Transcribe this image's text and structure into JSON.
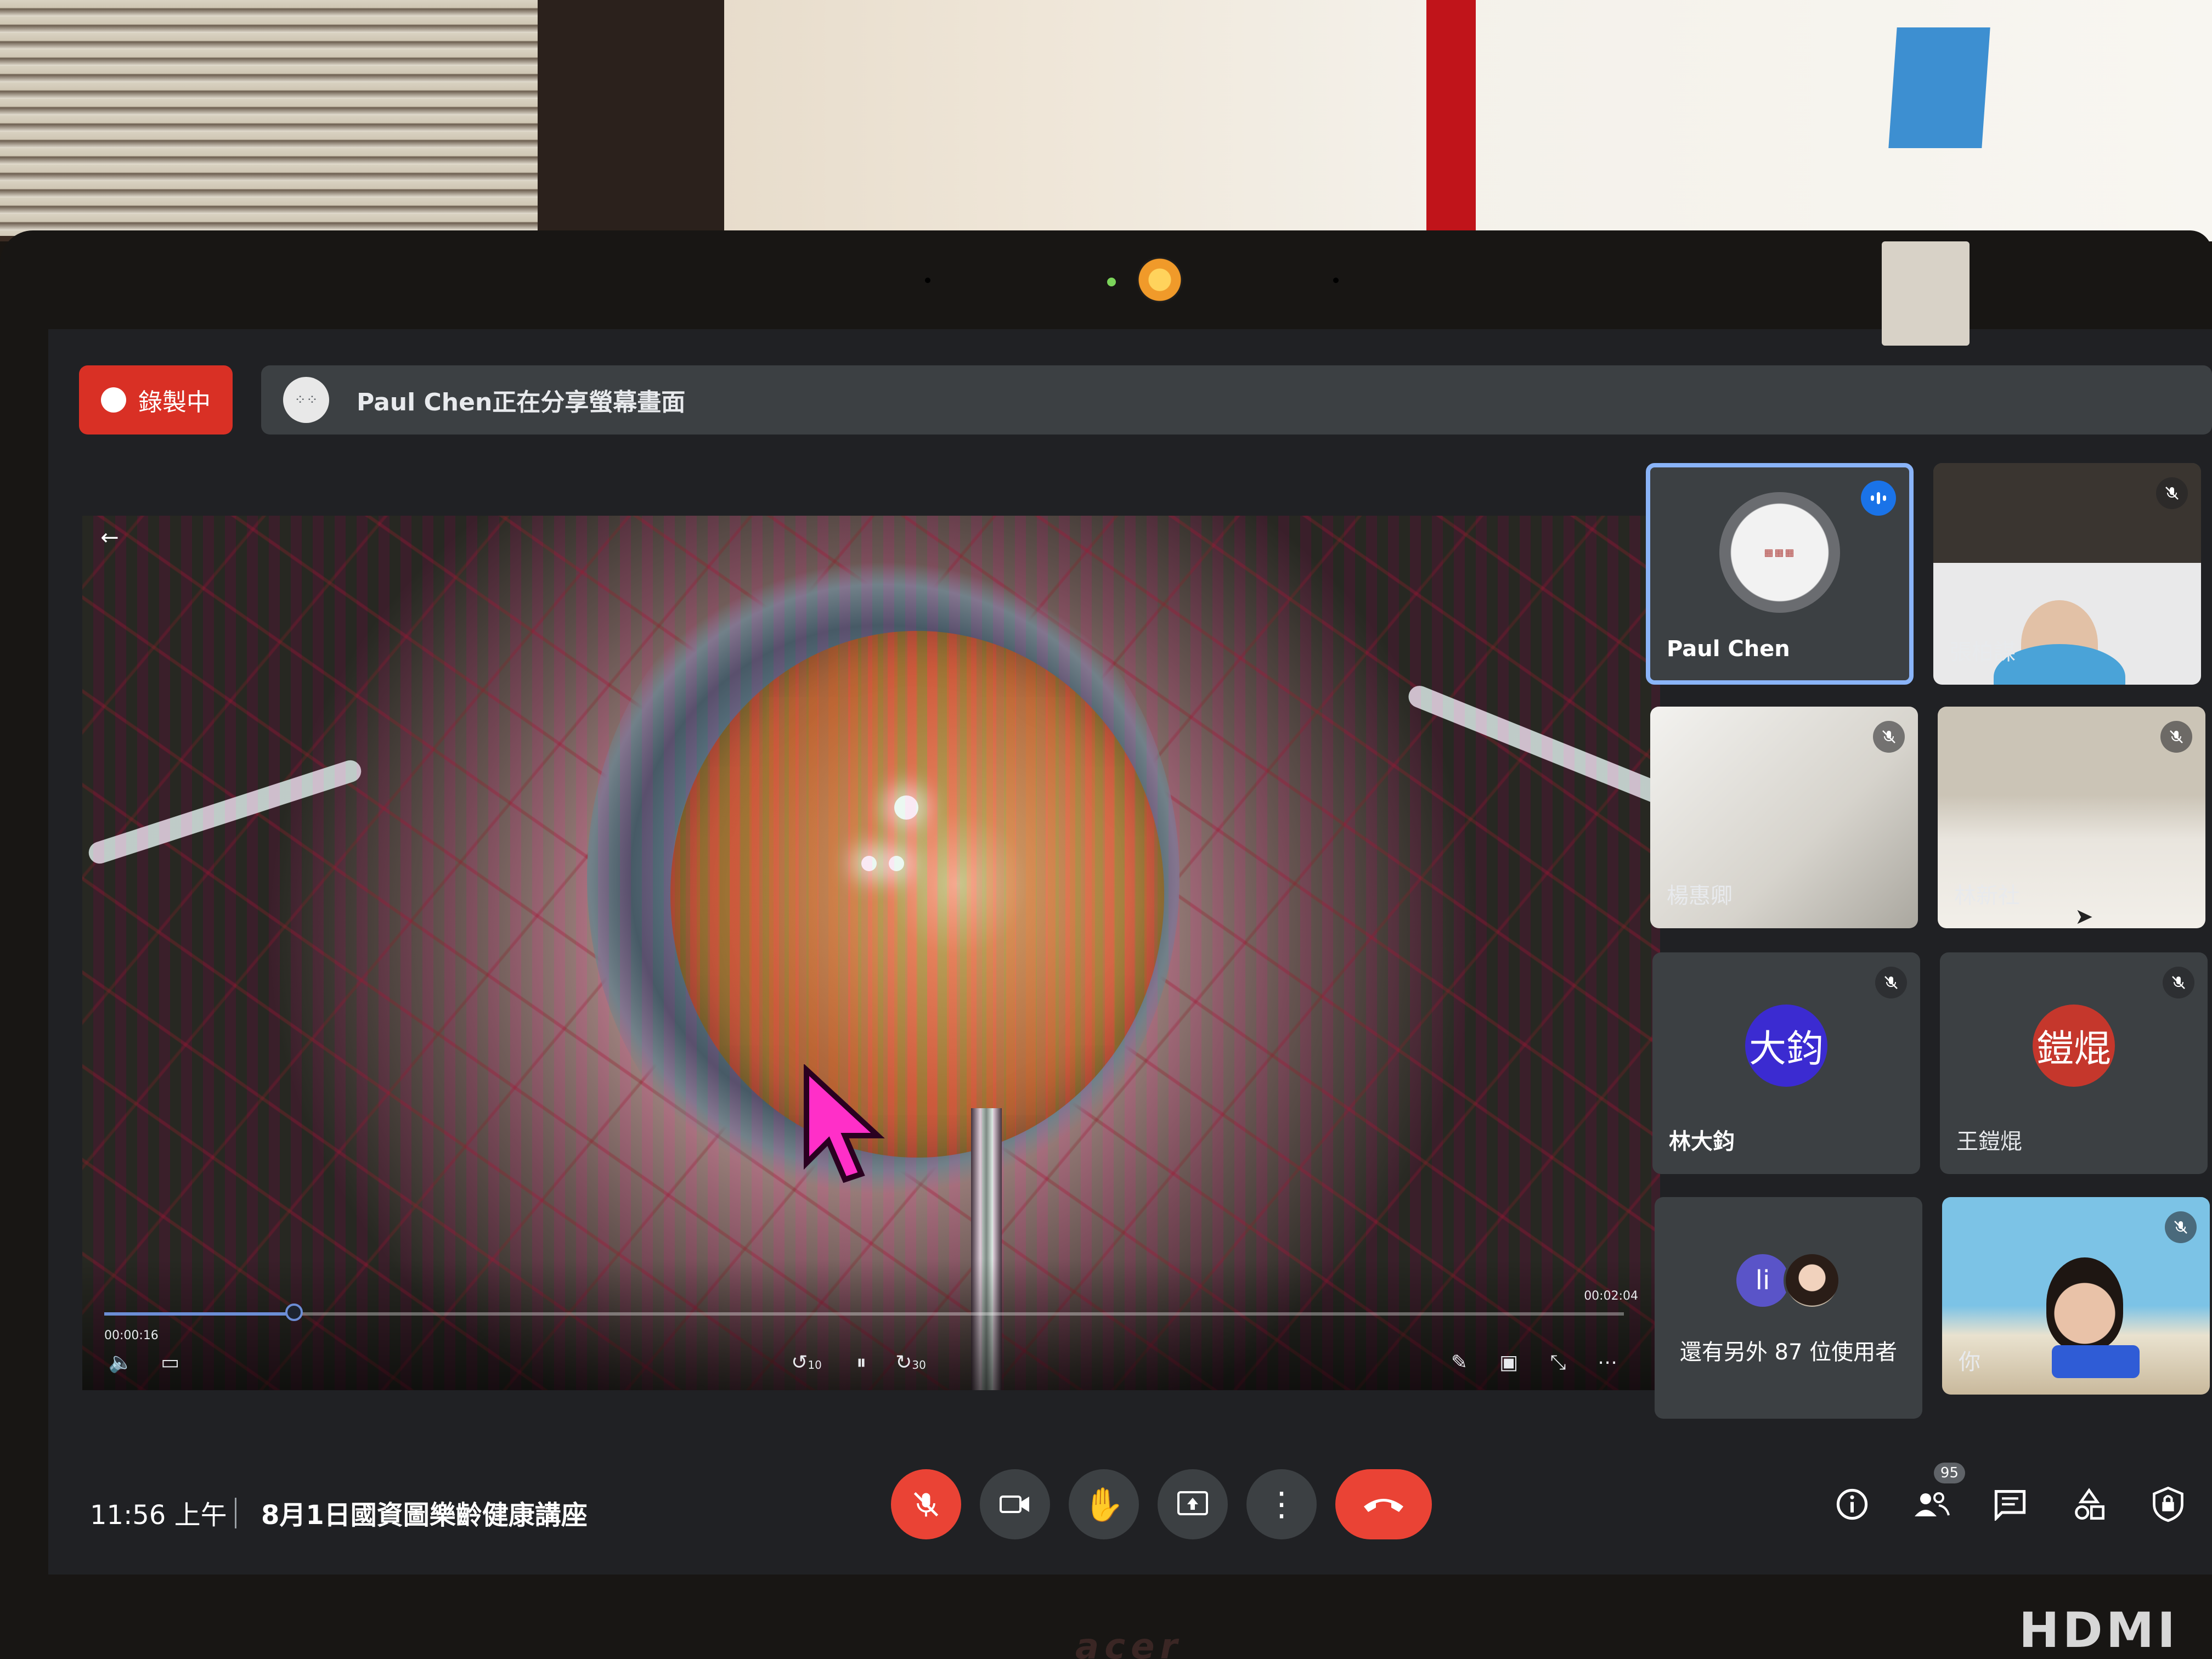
{
  "recording": {
    "label": "錄製中"
  },
  "share_banner": {
    "text": "Paul Chen正在分享螢幕畫面"
  },
  "video_player": {
    "current_time": "00:00:16",
    "duration": "00:02:04",
    "progress_fraction": 0.125,
    "icons": [
      "back-arrow-icon",
      "volume-icon",
      "captions-icon",
      "rewind-10-icon",
      "pause-icon",
      "forward-30-icon",
      "pen-icon",
      "miniplayer-icon",
      "exit-fullscreen-icon",
      "more-icon"
    ],
    "rewind_label": "10",
    "forward_label": "30"
  },
  "participants": [
    {
      "name": "Paul Chen",
      "state": "speaking",
      "type": "avatar"
    },
    {
      "name": "張柏謀",
      "state": "muted",
      "type": "camera"
    },
    {
      "name": "楊惠卿",
      "state": "muted",
      "type": "camera"
    },
    {
      "name": "林新社",
      "state": "muted",
      "type": "camera"
    },
    {
      "name": "林大鈞",
      "state": "muted",
      "type": "initials",
      "initials": "大鈞",
      "color": "#3b2bd1"
    },
    {
      "name": "王鎧焜",
      "state": "muted",
      "type": "initials",
      "initials": "鎧焜",
      "color": "#c5372c"
    },
    {
      "name": "你",
      "state": "muted",
      "type": "camera"
    }
  ],
  "others": {
    "text": "還有另外 87 位使用者",
    "initial": "li"
  },
  "bottom_bar": {
    "time": "11:56 上午",
    "meeting_title": "8月1日國資圖樂齡健康講座",
    "people_count": "95"
  },
  "colors": {
    "record_red": "#d93025",
    "hangup_red": "#ea4335",
    "speaking_blue": "#1a73e8",
    "active_border": "#8ab4f8"
  }
}
